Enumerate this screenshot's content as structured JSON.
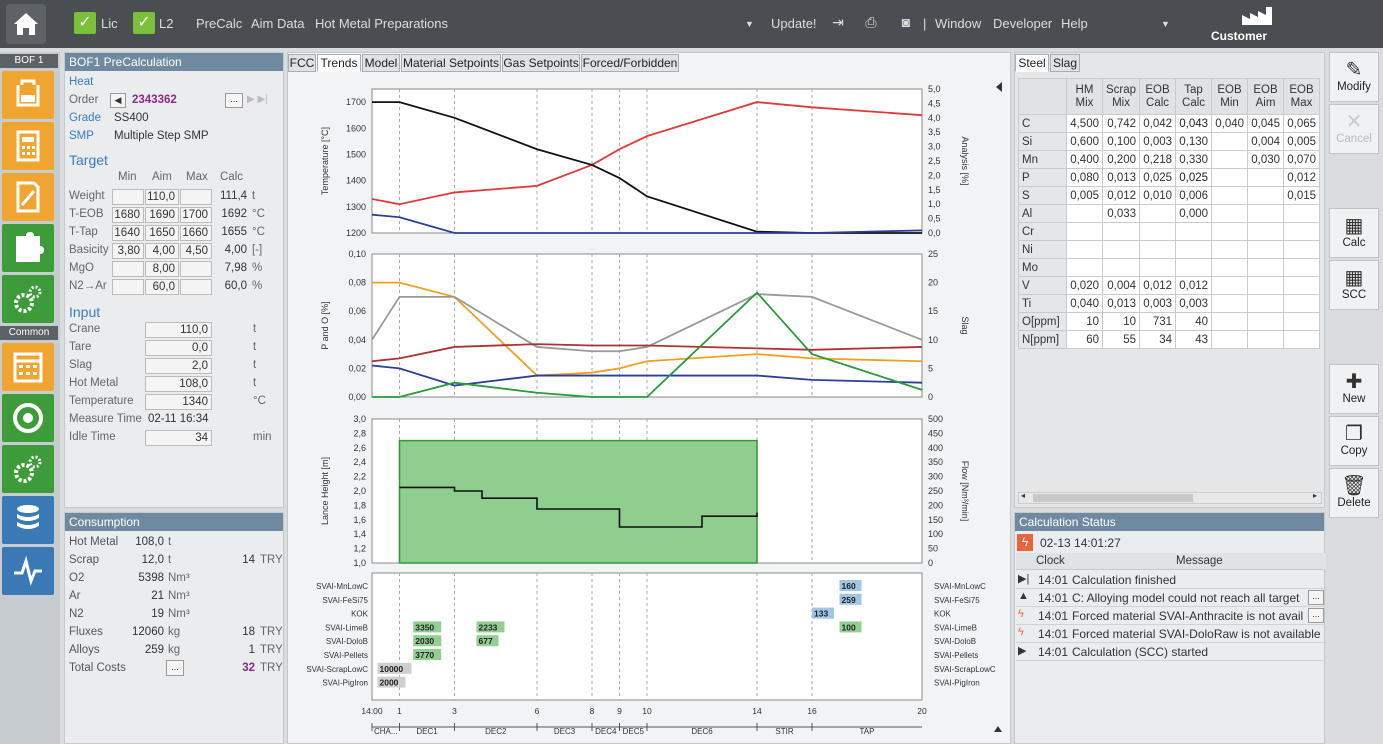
{
  "topbar": {
    "lic": "Lic",
    "l2": "L2",
    "menu": [
      "PreCalc",
      "Aim Data",
      "Hot Metal Preparations"
    ],
    "update": "Update!",
    "window": "Window",
    "developer": "Developer",
    "help": "Help",
    "customer": "Customer"
  },
  "leftbar": {
    "bof": "BOF 1",
    "common": "Common"
  },
  "precalc": {
    "title": "BOF1 PreCalculation",
    "heat_label": "Heat",
    "order_label": "Order",
    "order_value": "2343362",
    "grade_label": "Grade",
    "grade_value": "SS400",
    "smp_label": "SMP",
    "smp_value": "Multiple Step SMP",
    "target_title": "Target",
    "cols": [
      "Min",
      "Aim",
      "Max",
      "Calc"
    ],
    "target_rows": [
      {
        "label": "Weight",
        "min": "",
        "aim": "110,0",
        "max": "",
        "calc": "111,4",
        "unit": "t"
      },
      {
        "label": "T-EOB",
        "min": "1680",
        "aim": "1690",
        "max": "1700",
        "calc": "1692",
        "unit": "°C"
      },
      {
        "label": "T-Tap",
        "min": "1640",
        "aim": "1650",
        "max": "1660",
        "calc": "1655",
        "unit": "°C"
      },
      {
        "label": "Basicity",
        "min": "3,80",
        "aim": "4,00",
        "max": "4,50",
        "calc": "4,00",
        "unit": "[-]"
      },
      {
        "label": "MgO",
        "min": "",
        "aim": "8,00",
        "max": "",
        "calc": "7,98",
        "unit": "%"
      },
      {
        "label": "N2→Ar",
        "min": "",
        "aim": "60,0",
        "max": "",
        "calc": "60,0",
        "unit": "%"
      }
    ],
    "input_title": "Input",
    "input_rows": [
      {
        "label": "Crane",
        "value": "110,0",
        "unit": "t"
      },
      {
        "label": "Tare",
        "value": "0,0",
        "unit": "t"
      },
      {
        "label": "Slag",
        "value": "2,0",
        "unit": "t"
      },
      {
        "label": "Hot Metal",
        "value": "108,0",
        "unit": "t"
      },
      {
        "label": "Temperature",
        "value": "1340",
        "unit": "°C"
      },
      {
        "label": "Measure Time",
        "value": "02-11 16:34",
        "unit": ""
      },
      {
        "label": "Idle Time",
        "value": "34",
        "unit": "min"
      }
    ]
  },
  "consumption": {
    "title": "Consumption",
    "rows": [
      {
        "label": "Hot Metal",
        "value": "108,0",
        "unit": "t",
        "cost": "",
        "cur": ""
      },
      {
        "label": "Scrap",
        "value": "12,0",
        "unit": "t",
        "cost": "14",
        "cur": "TRY"
      },
      {
        "label": "O2",
        "value": "5398",
        "unit": "Nm³",
        "cost": "",
        "cur": ""
      },
      {
        "label": "Ar",
        "value": "21",
        "unit": "Nm³",
        "cost": "",
        "cur": ""
      },
      {
        "label": "N2",
        "value": "19",
        "unit": "Nm³",
        "cost": "",
        "cur": ""
      },
      {
        "label": "Fluxes",
        "value": "12060",
        "unit": "kg",
        "cost": "18",
        "cur": "TRY"
      },
      {
        "label": "Alloys",
        "value": "259",
        "unit": "kg",
        "cost": "1",
        "cur": "TRY"
      },
      {
        "label": "Total Costs",
        "value": "",
        "unit": "",
        "cost": "32",
        "cur": "TRY"
      }
    ]
  },
  "center_tabs": [
    "FCC",
    "Trends",
    "Model",
    "Material Setpoints",
    "Gas Setpoints",
    "Forced/Forbidden"
  ],
  "chart_data": [
    {
      "type": "line",
      "ylabel": "Temperature [°C]",
      "y2label": "Analysis [%]",
      "ylim": [
        1200,
        1750
      ],
      "yticks": [
        "1200",
        "1300",
        "1400",
        "1500",
        "1600",
        "1700"
      ],
      "y2lim": [
        0,
        5.0
      ],
      "y2ticks": [
        "0,0",
        "0,5",
        "1,0",
        "1,5",
        "2,0",
        "2,5",
        "3,0",
        "3,5",
        "4,0",
        "4,5",
        "5,0"
      ],
      "x": [
        0,
        1,
        3,
        6,
        8,
        9,
        10,
        14,
        16,
        20
      ],
      "series": [
        {
          "color": "#e03a3a",
          "values": [
            1330,
            1310,
            1355,
            1380,
            1460,
            1520,
            1570,
            1700,
            1680,
            1650
          ]
        },
        {
          "color": "#111111",
          "values": [
            1700,
            1700,
            1640,
            1520,
            1460,
            1410,
            1340,
            1205,
            1200,
            1200
          ]
        },
        {
          "color": "#2a3f9a",
          "values": [
            1270,
            1260,
            1200,
            1200,
            1200,
            1200,
            1200,
            1200,
            1200,
            1210
          ]
        }
      ]
    },
    {
      "type": "line",
      "ylabel": "P and O [%]",
      "y2label": "Slag",
      "ylim": [
        0,
        0.1
      ],
      "yticks": [
        "0,00",
        "0,02",
        "0,04",
        "0,06",
        "0,08",
        "0,10"
      ],
      "y2lim": [
        0,
        25
      ],
      "y2ticks": [
        "0",
        "5",
        "10",
        "15",
        "20",
        "25"
      ],
      "x": [
        0,
        1,
        3,
        6,
        8,
        9,
        10,
        14,
        16,
        20
      ],
      "series": [
        {
          "color": "#f0a020",
          "values": [
            0.08,
            0.08,
            0.07,
            0.015,
            0.017,
            0.02,
            0.025,
            0.03,
            0.027,
            0.025
          ]
        },
        {
          "color": "#999999",
          "values": [
            0.04,
            0.07,
            0.07,
            0.035,
            0.032,
            0.032,
            0.035,
            0.072,
            0.07,
            0.04
          ]
        },
        {
          "color": "#aa3333",
          "values": [
            0.025,
            0.027,
            0.035,
            0.037,
            0.036,
            0.036,
            0.036,
            0.034,
            0.033,
            0.035
          ]
        },
        {
          "color": "#2a3f9a",
          "values": [
            0.022,
            0.02,
            0.008,
            0.015,
            0.015,
            0.015,
            0.015,
            0.015,
            0.012,
            0.01
          ]
        },
        {
          "color": "#2a9a3a",
          "values": [
            0,
            0,
            0.01,
            0.003,
            0,
            0,
            0,
            0.073,
            0.03,
            0.005
          ]
        }
      ]
    },
    {
      "type": "area",
      "ylabel": "Lance Height [m]",
      "y2label": "Flow [Nm³/min]",
      "ylim": [
        1.0,
        3.0
      ],
      "yticks": [
        "1,0",
        "1,2",
        "1,4",
        "1,6",
        "1,8",
        "2,0",
        "2,2",
        "2,4",
        "2,6",
        "2,8",
        "3,0"
      ],
      "y2lim": [
        0,
        500
      ],
      "y2ticks": [
        "0",
        "50",
        "100",
        "150",
        "200",
        "250",
        "300",
        "350",
        "400",
        "450",
        "500"
      ],
      "series": [
        {
          "name": "O2 flow",
          "color": "#2a9a3a",
          "x": [
            1,
            14
          ],
          "values": [
            425,
            425
          ]
        },
        {
          "name": "Lance",
          "color": "#111111",
          "x": [
            1,
            3,
            4,
            6,
            9,
            10,
            12,
            14
          ],
          "values": [
            2.05,
            2.0,
            1.9,
            1.75,
            1.5,
            1.5,
            1.65,
            1.7
          ]
        }
      ]
    },
    {
      "type": "table",
      "xticks": [
        "14:00",
        "1",
        "3",
        "6",
        "8",
        "9",
        "10",
        "14",
        "16",
        "20"
      ],
      "phases": [
        "CHA...",
        "DEC1",
        "DEC2",
        "DEC3",
        "DEC4",
        "DEC5",
        "DEC6",
        "STIR",
        "TAP"
      ],
      "materials": [
        "SVAI-MnLowC",
        "SVAI-FeSi75",
        "KOK",
        "SVAI-LimeB",
        "SVAI-DoloB",
        "SVAI-Pellets",
        "SVAI-ScrapLowC",
        "SVAI-PigIron"
      ],
      "labels": [
        {
          "row": "SVAI-MnLowC",
          "x": 17,
          "text": "160"
        },
        {
          "row": "SVAI-FeSi75",
          "x": 17,
          "text": "259"
        },
        {
          "row": "KOK",
          "x": 16,
          "text": "133"
        },
        {
          "row": "SVAI-LimeB",
          "x": 1.5,
          "text": "3350"
        },
        {
          "row": "SVAI-LimeB",
          "x": 3.8,
          "text": "2233"
        },
        {
          "row": "SVAI-LimeB",
          "x": 17,
          "text": "100"
        },
        {
          "row": "SVAI-DoloB",
          "x": 1.5,
          "text": "2030"
        },
        {
          "row": "SVAI-DoloB",
          "x": 3.8,
          "text": "677"
        },
        {
          "row": "SVAI-Pellets",
          "x": 1.5,
          "text": "3770"
        },
        {
          "row": "SVAI-ScrapLowC",
          "x": 0.2,
          "text": "10000"
        },
        {
          "row": "SVAI-PigIron",
          "x": 0.2,
          "text": "2000"
        }
      ]
    }
  ],
  "right_tabs": [
    "Steel",
    "Slag"
  ],
  "steel": {
    "cols": [
      "HM\nMix",
      "Scrap\nMix",
      "EOB\nCalc",
      "Tap\nCalc",
      "EOB\nMin",
      "EOB\nAim",
      "EOB\nMax"
    ],
    "rows": [
      [
        "C",
        "4,500",
        "0,742",
        "0,042",
        "0,043",
        "0,040",
        "0,045",
        "0,065"
      ],
      [
        "Si",
        "0,600",
        "0,100",
        "0,003",
        "0,130",
        "",
        "0,004",
        "0,005"
      ],
      [
        "Mn",
        "0,400",
        "0,200",
        "0,218",
        "0,330",
        "",
        "0,030",
        "0,070"
      ],
      [
        "P",
        "0,080",
        "0,013",
        "0,025",
        "0,025",
        "",
        "",
        "0,012"
      ],
      [
        "S",
        "0,005",
        "0,012",
        "0,010",
        "0,006",
        "",
        "",
        "0,015"
      ],
      [
        "Al",
        "",
        "0,033",
        "",
        "0,000",
        "",
        "",
        ""
      ],
      [
        "Cr",
        "",
        "",
        "",
        "",
        "",
        "",
        ""
      ],
      [
        "Ni",
        "",
        "",
        "",
        "",
        "",
        "",
        ""
      ],
      [
        "Mo",
        "",
        "",
        "",
        "",
        "",
        "",
        ""
      ],
      [
        "V",
        "0,020",
        "0,004",
        "0,012",
        "0,012",
        "",
        "",
        ""
      ],
      [
        "Ti",
        "0,040",
        "0,013",
        "0,003",
        "0,003",
        "",
        "",
        ""
      ],
      [
        "O[ppm]",
        "10",
        "10",
        "731",
        "40",
        "",
        "",
        ""
      ],
      [
        "N[ppm]",
        "60",
        "55",
        "34",
        "43",
        "",
        "",
        ""
      ]
    ]
  },
  "calc_status": {
    "title": "Calculation Status",
    "time": "02-13 14:01:27",
    "cols": [
      "Clock",
      "Message"
    ],
    "rows": [
      {
        "clock": "14:01",
        "msg": "Calculation finished"
      },
      {
        "clock": "14:01",
        "msg": "C: Alloying model could not reach all target"
      },
      {
        "clock": "14:01",
        "msg": "Forced material SVAI-Anthracite is not avail"
      },
      {
        "clock": "14:01",
        "msg": "Forced material SVAI-DoloRaw is not available"
      },
      {
        "clock": "14:01",
        "msg": "Calculation (SCC) started"
      }
    ]
  },
  "buttons": {
    "modify": "Modify",
    "cancel": "Cancel",
    "calc": "Calc",
    "scc": "SCC",
    "new": "New",
    "copy": "Copy",
    "delete": "Delete"
  }
}
